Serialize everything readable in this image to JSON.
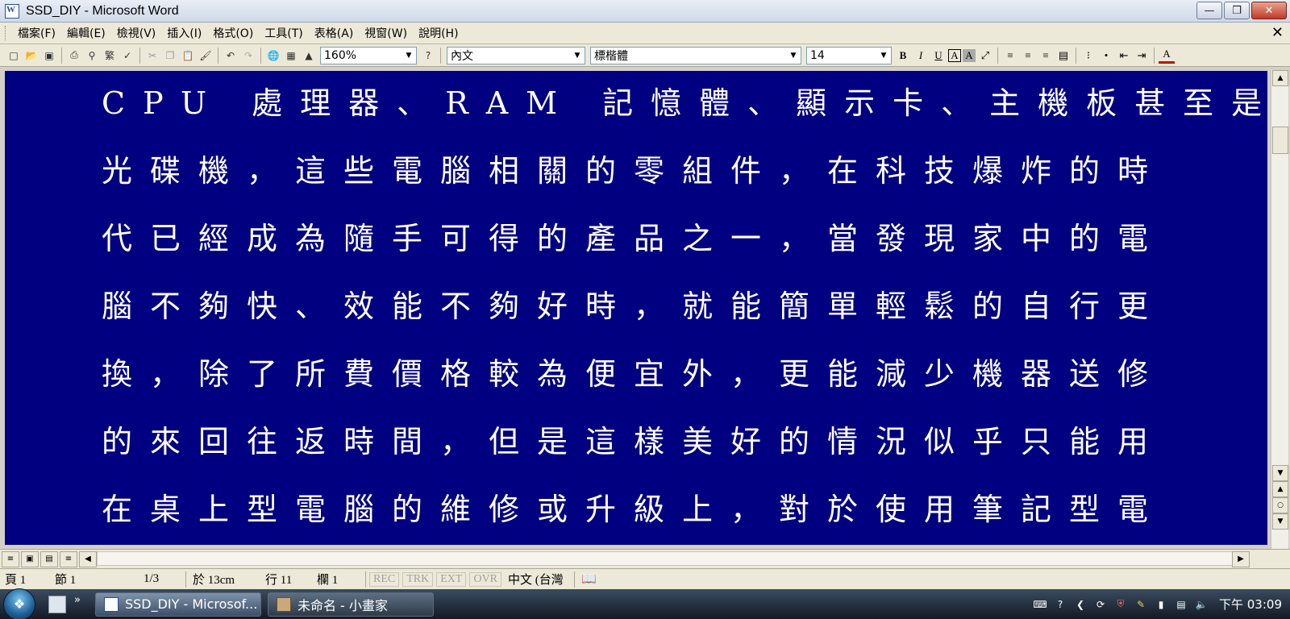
{
  "window": {
    "title": "SSD_DIY - Microsoft Word"
  },
  "menu": [
    "檔案(F)",
    "編輯(E)",
    "檢視(V)",
    "插入(I)",
    "格式(O)",
    "工具(T)",
    "表格(A)",
    "視窗(W)",
    "說明(H)"
  ],
  "toolbar": {
    "zoom": "160%",
    "style": "內文",
    "font": "標楷體",
    "size": "14",
    "trad_simplified": "繁"
  },
  "document": {
    "lines": [
      "CPU 處理器、RAM 記憶體、顯示卡、主機板甚至是",
      "光碟機，這些電腦相關的零組件，在科技爆炸的時",
      "代已經成為隨手可得的產品之一，當發現家中的電",
      "腦不夠快、效能不夠好時，就能簡單輕鬆的自行更",
      "換，除了所費價格較為便宜外，更能減少機器送修",
      "的來回往返時間，但是這樣美好的情況似乎只能用",
      "在桌上型電腦的維修或升級上，對於使用筆記型電"
    ],
    "background_color": "#000080",
    "text_color": "#ffffff"
  },
  "status": {
    "page": "頁 1",
    "section": "節 1",
    "pages": "1/3",
    "at": "於 13cm",
    "line": "行 11",
    "column": "欄 1",
    "rec": "REC",
    "trk": "TRK",
    "ext": "EXT",
    "ovr": "OVR",
    "language": "中文 (台灣"
  },
  "taskbar": {
    "tasks": [
      {
        "label": "SSD_DIY - Microsof...",
        "active": true
      },
      {
        "label": "未命名 - 小畫家",
        "active": false
      }
    ],
    "clock": "下午 03:09"
  }
}
